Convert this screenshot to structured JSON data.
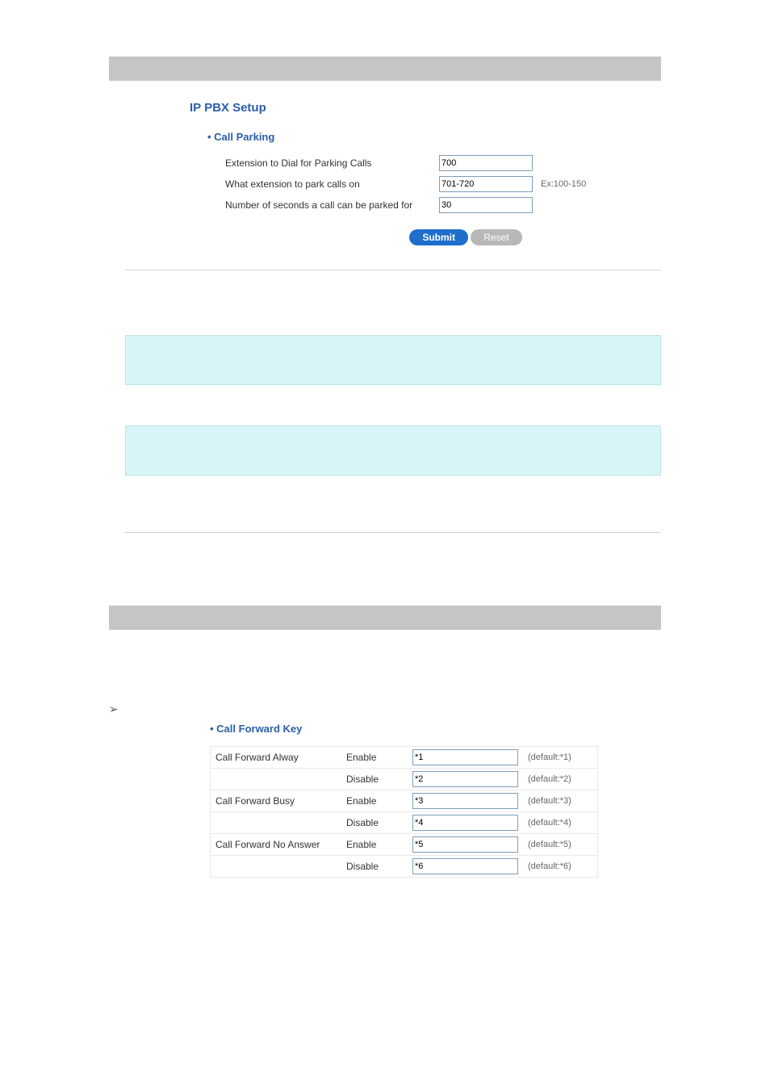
{
  "top": {
    "title": "IP PBX Setup",
    "section": "Call Parking",
    "rows": [
      {
        "label": "Extension to Dial for Parking Calls",
        "value": "700",
        "hint": ""
      },
      {
        "label": "What extension to park calls on",
        "value": "701-720",
        "hint": "Ex:100-150"
      },
      {
        "label": "Number of seconds a call can be parked for",
        "value": "30",
        "hint": ""
      }
    ],
    "submit": "Submit",
    "reset": "Reset"
  },
  "cfk": {
    "title": "Call Forward Key",
    "rows": [
      {
        "name": "Call Forward Alway",
        "stat": "Enable",
        "val": "*1",
        "def": "(default:*1)"
      },
      {
        "name": "",
        "stat": "Disable",
        "val": "*2",
        "def": "(default:*2)"
      },
      {
        "name": "Call Forward Busy",
        "stat": "Enable",
        "val": "*3",
        "def": "(default:*3)"
      },
      {
        "name": "",
        "stat": "Disable",
        "val": "*4",
        "def": "(default:*4)"
      },
      {
        "name": "Call Forward No Answer",
        "stat": "Enable",
        "val": "*5",
        "def": "(default:*5)"
      },
      {
        "name": "",
        "stat": "Disable",
        "val": "*6",
        "def": "(default:*6)"
      }
    ]
  }
}
